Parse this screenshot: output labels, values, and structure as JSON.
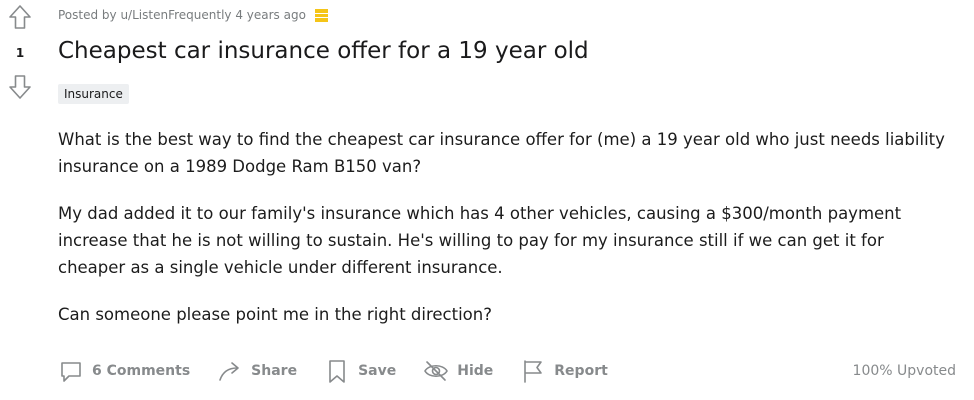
{
  "post": {
    "score": "1",
    "meta": "Posted by u/ListenFrequently 4 years ago",
    "title": "Cheapest car insurance offer for a 19 year old",
    "flair": "Insurance",
    "body": [
      "What is the best way to find the cheapest car insurance offer for (me) a 19 year old who just needs liability insurance on a 1989 Dodge Ram B150 van?",
      "My dad added it to our family's insurance which has 4 other vehicles, causing a $300/month payment increase that he is not willing to sustain. He's willing to pay for my insurance still if we can get it for cheaper as a single vehicle under different insurance.",
      "Can someone please point me in the right direction?"
    ]
  },
  "actions": {
    "comments": "6 Comments",
    "share": "Share",
    "save": "Save",
    "hide": "Hide",
    "report": "Report"
  },
  "upvoted": "100% Upvoted",
  "icons": {
    "upvote": "upvote-arrow-icon",
    "downvote": "downvote-arrow-icon",
    "award": "award-icon",
    "comments": "comment-bubble-icon",
    "share": "share-arrow-icon",
    "save": "bookmark-icon",
    "hide": "eye-slash-icon",
    "report": "flag-icon"
  },
  "colors": {
    "text": "#1c1c1c",
    "muted": "#878a8c",
    "meta": "#787c7e",
    "flair_bg": "#edeff1",
    "award": "#f5c518"
  }
}
